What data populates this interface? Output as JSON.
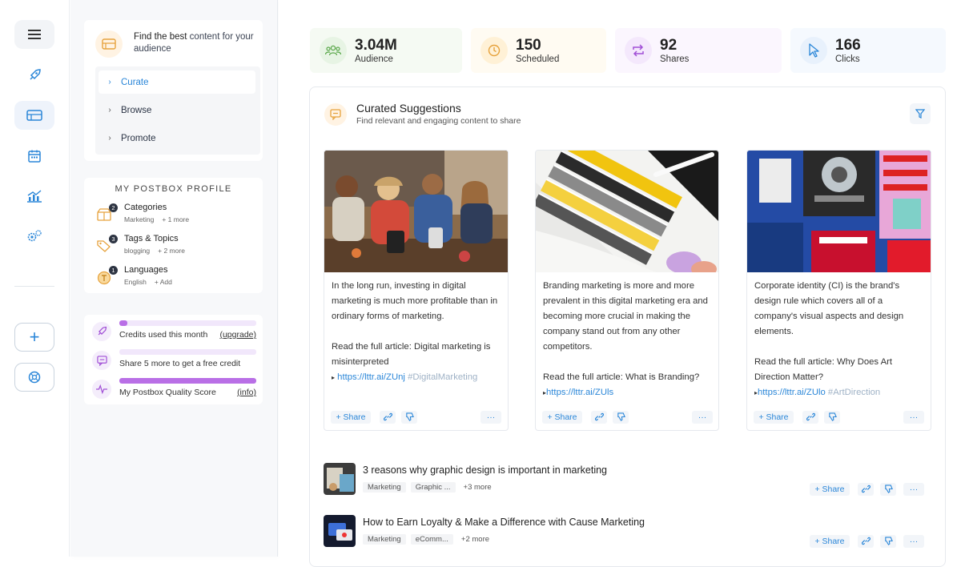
{
  "rail": {
    "items": [
      {
        "icon": "hamburger-menu-icon",
        "glyph": "☰"
      },
      {
        "icon": "rocket-icon",
        "glyph": "🚀"
      },
      {
        "icon": "content-card-icon",
        "glyph": "▭"
      },
      {
        "icon": "calendar-icon",
        "glyph": "▦"
      },
      {
        "icon": "analytics-chart-icon",
        "glyph": "📈"
      },
      {
        "icon": "settings-gear-icon",
        "glyph": "⚙"
      }
    ],
    "add_glyph": "+",
    "globe_glyph": "◎"
  },
  "sidebar": {
    "find": {
      "text_bold": "Find the best",
      "text_rest": " content for your audience"
    },
    "nav": [
      {
        "label": "Curate",
        "active": true
      },
      {
        "label": "Browse",
        "active": false
      },
      {
        "label": "Promote",
        "active": false
      }
    ],
    "profile": {
      "title": "MY POSTBOX PROFILE",
      "rows": [
        {
          "badge": "2",
          "name": "Categories",
          "value": "Marketing",
          "extra": "+ 1 more",
          "icon": "categories-box-icon"
        },
        {
          "badge": "3",
          "name": "Tags & Topics",
          "value": "blogging",
          "extra": "+ 2 more",
          "icon": "tags-icon"
        },
        {
          "badge": "1",
          "name": "Languages",
          "value": "English",
          "extra": "+ Add",
          "icon": "language-icon"
        }
      ]
    },
    "credits": [
      {
        "text": "Credits used this month",
        "link": "(upgrade)",
        "fill": 0.06,
        "icon": "rocket-icon"
      },
      {
        "text": "Share 5 more to get a free credit",
        "link": "",
        "fill": 0.0,
        "icon": "chat-icon"
      },
      {
        "text": "My Postbox Quality Score",
        "link": "(info)",
        "fill": 1.0,
        "icon": "pulse-icon"
      }
    ]
  },
  "stats": [
    {
      "value": "3.04M",
      "label": "Audience",
      "icon": "audience-icon",
      "glyph": "👥",
      "bg": "#f5faf3",
      "icon_bg": "#e7f4e4",
      "icon_color": "#5aa84a"
    },
    {
      "value": "150",
      "label": "Scheduled",
      "icon": "clock-icon",
      "glyph": "◷",
      "bg": "#fffbf2",
      "icon_bg": "#fff1d6",
      "icon_color": "#e6a23c"
    },
    {
      "value": "92",
      "label": "Shares",
      "icon": "repeat-icon",
      "glyph": "⇄",
      "bg": "#fbf6fe",
      "icon_bg": "#f4e8fc",
      "icon_color": "#a14fd6"
    },
    {
      "value": "166",
      "label": "Clicks",
      "icon": "cursor-icon",
      "glyph": "➚",
      "bg": "#f5f9fe",
      "icon_bg": "#e8f1fc",
      "icon_color": "#2a86d8"
    }
  ],
  "panel": {
    "title": "Curated Suggestions",
    "subtitle": "Find relevant and engaging content to share"
  },
  "articles": [
    {
      "paras": [
        "In the long run, investing in digital marketing is much more profitable than in ordinary forms of marketing.",
        "Read the full article: Digital marketing is misinterpreted"
      ],
      "link": "https://lttr.ai/ZUnj",
      "tag": "#DigitalMarketing"
    },
    {
      "paras": [
        "Branding marketing is more and more prevalent in this digital marketing era and becoming more crucial in making the company stand out from any other competitors.",
        "Read the full article: What is Branding?"
      ],
      "link": "https://lttr.ai/ZUls",
      "tag": ""
    },
    {
      "paras": [
        "Corporate identity (CI) is the brand's design rule which covers all of a company's visual aspects and design elements.",
        "Read the full article: Why Does Art Direction Matter?"
      ],
      "link": "https://lttr.ai/ZUlo",
      "tag": "#ArtDirection"
    }
  ],
  "actions": {
    "share": "+ Share",
    "more": "···"
  },
  "rows": [
    {
      "title": "3 reasons why graphic design is important in marketing",
      "tags": [
        "Marketing",
        "Graphic ..."
      ],
      "more": "+3 more"
    },
    {
      "title": "How to Earn Loyalty & Make a Difference with Cause Marketing",
      "tags": [
        "Marketing",
        "eComm..."
      ],
      "more": "+2 more"
    }
  ]
}
